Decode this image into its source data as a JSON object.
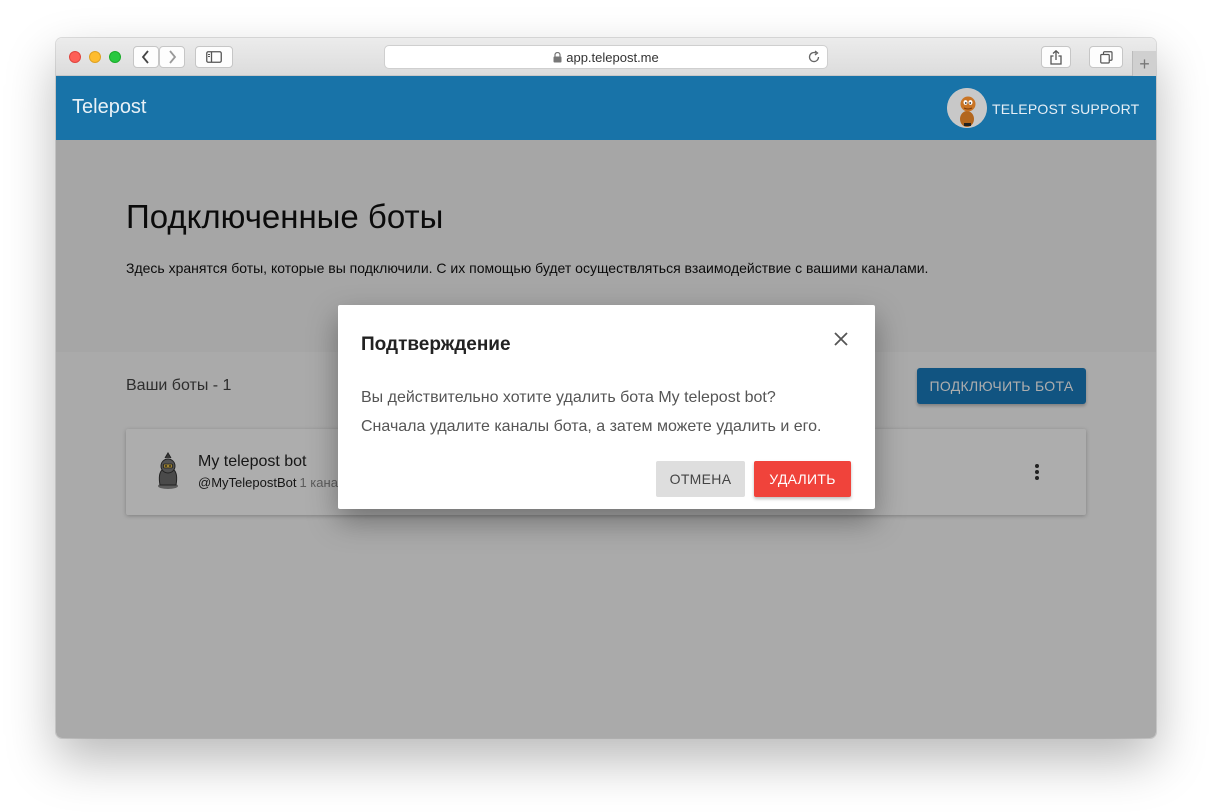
{
  "browser": {
    "url": "app.telepost.me"
  },
  "header": {
    "app_title": "Telepost",
    "user_name": "TELEPOST SUPPORT"
  },
  "page": {
    "title": "Подключенные боты",
    "description": "Здесь хранятся боты, которые вы подключили. С их помощью будет осуществляться взаимодействие с вашими каналами."
  },
  "bots": {
    "count_label": "Ваши боты - 1",
    "connect_button": "ПОДКЛЮЧИТЬ БОТА",
    "items": [
      {
        "name": "My telepost bot",
        "handle": "@MyTelepostBot",
        "channels": "1 кана"
      }
    ]
  },
  "dialog": {
    "title": "Подтверждение",
    "line1": "Вы действительно хотите удалить бота My telepost bot?",
    "line2": "Сначала удалите каналы бота, а затем можете удалить и его.",
    "cancel_label": "ОТМЕНА",
    "delete_label": "УДАЛИТЬ"
  },
  "colors": {
    "header_bg": "#1873a8",
    "primary_button": "#1a7dbf",
    "danger_button": "#f0433b"
  },
  "icons": [
    "lock-icon",
    "reload-icon",
    "back-icon",
    "forward-icon",
    "sidebar-icon",
    "share-icon",
    "tabs-icon",
    "close-icon",
    "more-vert-icon",
    "bot-icon",
    "avatar"
  ]
}
